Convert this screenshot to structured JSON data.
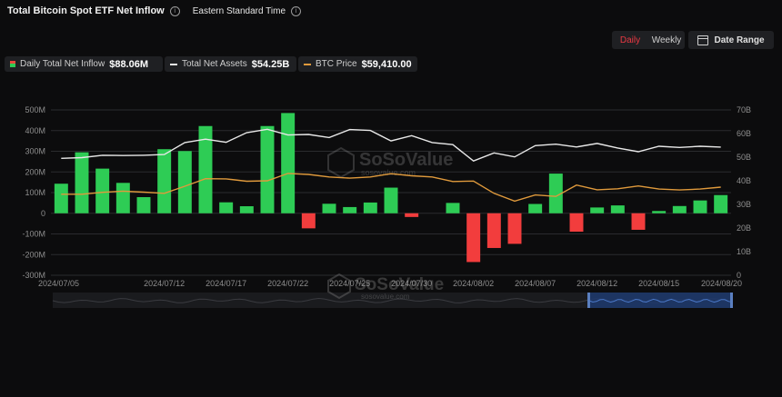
{
  "header": {
    "title": "Total Bitcoin Spot ETF Net Inflow",
    "timezone": "Eastern Standard Time"
  },
  "controls": {
    "daily": "Daily",
    "weekly": "Weekly",
    "date_range": "Date Range"
  },
  "legend": {
    "inflow_label": "Daily Total Net Inflow",
    "inflow_value": "$88.06M",
    "assets_label": "Total Net Assets",
    "assets_value": "$54.25B",
    "btc_label": "BTC Price",
    "btc_value": "$59,410.00"
  },
  "watermark": {
    "brand": "SoSoValue",
    "url": "sosovalue.com"
  },
  "colors": {
    "positive": "#2ecc55",
    "negative": "#f23d3d",
    "assets_line": "#e8e8e8",
    "btc_line": "#e09a3c",
    "grid": "#2a2b2e",
    "range_highlight": "#1e3a6e"
  },
  "chart_data": {
    "type": "bar",
    "x": [
      "2024/07/05",
      "2024/07/08",
      "2024/07/09",
      "2024/07/10",
      "2024/07/11",
      "2024/07/12",
      "2024/07/15",
      "2024/07/16",
      "2024/07/17",
      "2024/07/18",
      "2024/07/19",
      "2024/07/22",
      "2024/07/23",
      "2024/07/24",
      "2024/07/25",
      "2024/07/26",
      "2024/07/29",
      "2024/07/30",
      "2024/07/31",
      "2024/08/01",
      "2024/08/02",
      "2024/08/05",
      "2024/08/06",
      "2024/08/07",
      "2024/08/08",
      "2024/08/09",
      "2024/08/12",
      "2024/08/13",
      "2024/08/14",
      "2024/08/15",
      "2024/08/16",
      "2024/08/19",
      "2024/08/20"
    ],
    "x_ticks": [
      "2024/07/05",
      "2024/07/12",
      "2024/07/17",
      "2024/07/22",
      "2024/07/25",
      "2024/07/30",
      "2024/08/02",
      "2024/08/07",
      "2024/08/12",
      "2024/08/15",
      "2024/08/20"
    ],
    "series": [
      {
        "name": "Daily Total Net Inflow",
        "type": "bar",
        "axis": "left",
        "values": [
          143,
          295,
          216,
          147,
          78,
          310,
          301,
          422,
          53,
          34,
          422,
          485,
          -73,
          46,
          30,
          52,
          124,
          -18,
          0,
          50,
          -236,
          -168,
          -148,
          45,
          192,
          -89,
          28,
          38,
          -80,
          11,
          35,
          62,
          88
        ]
      },
      {
        "name": "Total Net Assets",
        "type": "line",
        "axis": "right",
        "values": [
          49.5,
          49.8,
          50.8,
          50.7,
          50.8,
          51.1,
          56.2,
          57.6,
          56.3,
          60.4,
          61.8,
          59.4,
          59.6,
          58.3,
          61.7,
          61.3,
          56.9,
          59.1,
          56.2,
          55.3,
          48.4,
          51.8,
          50.1,
          54.9,
          55.5,
          54.3,
          55.8,
          53.9,
          52.3,
          54.6,
          54.1,
          54.6,
          54.25
        ]
      },
      {
        "name": "BTC Price",
        "type": "line",
        "axis": "right",
        "values": [
          34.3,
          34.3,
          35.1,
          35.6,
          35.2,
          34.7,
          37.7,
          40.9,
          40.8,
          39.8,
          40.0,
          43.1,
          42.7,
          41.6,
          41.1,
          41.6,
          43.0,
          42.1,
          41.6,
          39.7,
          39.9,
          34.7,
          31.4,
          34.0,
          33.4,
          38.2,
          36.2,
          36.6,
          37.8,
          36.5,
          36.1,
          36.5,
          37.3
        ]
      }
    ],
    "y_left": {
      "ticks": [
        "500M",
        "400M",
        "300M",
        "200M",
        "100M",
        "0",
        "-100M",
        "-200M",
        "-300M"
      ],
      "ylim": [
        -300,
        500
      ],
      "unit": "M"
    },
    "y_right": {
      "ticks": [
        "70B",
        "60B",
        "50B",
        "40B",
        "30B",
        "20B",
        "10B",
        "0"
      ],
      "ylim": [
        0,
        70
      ],
      "unit": "B"
    },
    "grid": true,
    "legend_position": "top-left"
  }
}
